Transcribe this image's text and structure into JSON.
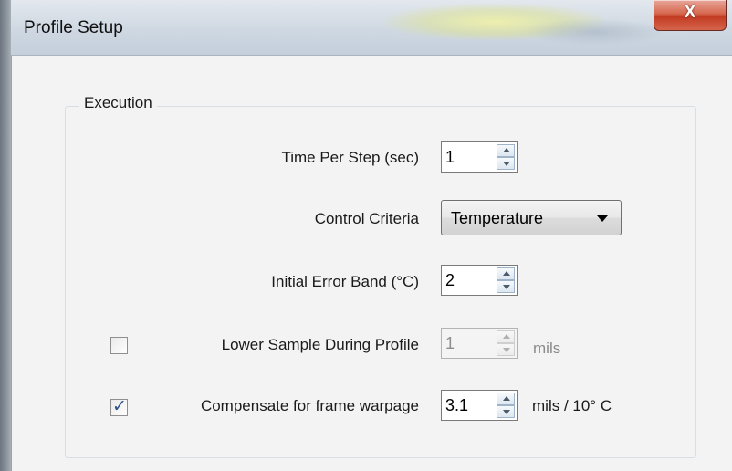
{
  "window": {
    "title": "Profile Setup",
    "close_label": "X"
  },
  "execution": {
    "group_label": "Execution",
    "time_per_step": {
      "label": "Time Per Step (sec)",
      "value": "1"
    },
    "control_criteria": {
      "label": "Control Criteria",
      "selected": "Temperature"
    },
    "initial_error_band": {
      "label": "Initial Error Band (°C)",
      "value": "2"
    },
    "lower_sample": {
      "checked": false,
      "label": "Lower Sample During Profile",
      "value": "1",
      "unit": "mils",
      "enabled": false
    },
    "compensate": {
      "checked": true,
      "label": "Compensate for frame warpage",
      "value": "3.1",
      "unit": "mils / 10° C",
      "enabled": true
    }
  },
  "colors": {
    "accent": "#2d4f86",
    "close": "#c23b22"
  }
}
